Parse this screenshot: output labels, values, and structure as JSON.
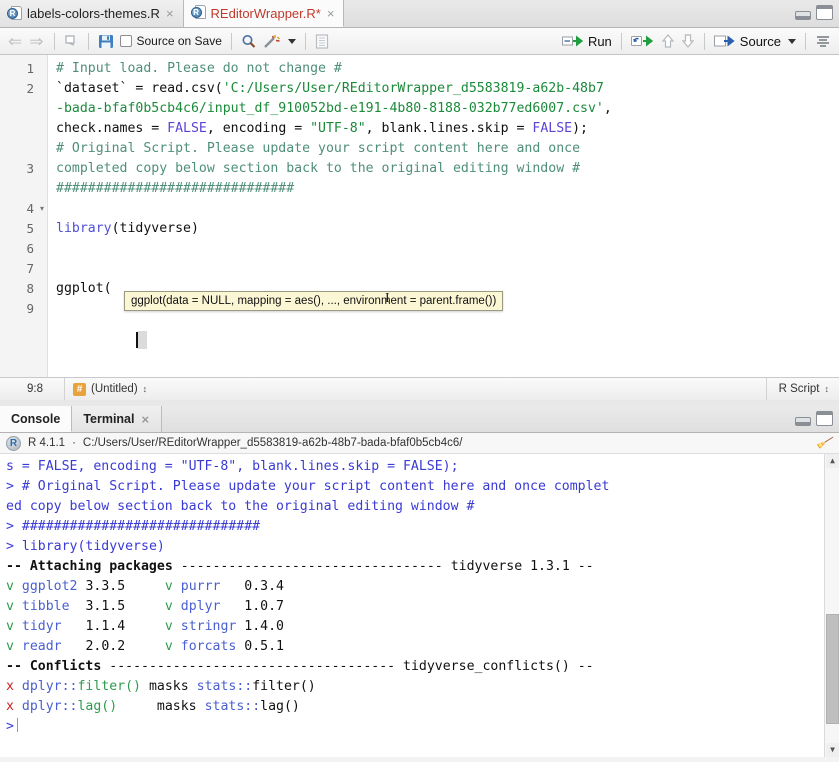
{
  "source_pane": {
    "tabs": [
      {
        "label": "labels-colors-themes.R",
        "modified": false,
        "active": false,
        "close": "×",
        "icon": "r-document-icon"
      },
      {
        "label": "REditorWrapper.R*",
        "modified": true,
        "active": true,
        "close": "×",
        "icon": "r-document-icon"
      }
    ],
    "window_controls": {
      "minimize": "minimize-icon",
      "maximize": "maximize-icon"
    },
    "toolbar": {
      "back": "⇐",
      "forward": "⇒",
      "show_document_outline_left": "popout-icon",
      "save_label": "save-icon",
      "source_on_save_label": "Source on Save",
      "find_label": "search-icon",
      "code_tools_label": "magic-wand-icon",
      "compile_report_label": "notebook-icon",
      "run_label": "Run",
      "rerun_label": "rerun-icon",
      "prev_chunk_label": "⇧",
      "next_chunk_label": "⇩",
      "source_label": "Source",
      "outline_label": "outline-icon"
    },
    "editor": {
      "lines": [
        {
          "num": "1",
          "fold": ""
        },
        {
          "num": "2",
          "fold": ""
        },
        {
          "num": "",
          "fold": ""
        },
        {
          "num": "",
          "fold": ""
        },
        {
          "num": "3",
          "fold": ""
        },
        {
          "num": "",
          "fold": ""
        },
        {
          "num": "4",
          "fold": "▾"
        },
        {
          "num": "5",
          "fold": ""
        },
        {
          "num": "6",
          "fold": ""
        },
        {
          "num": "7",
          "fold": ""
        },
        {
          "num": "8",
          "fold": ""
        },
        {
          "num": "9",
          "fold": ""
        }
      ],
      "code": {
        "l1_comment": "# Input load. Please do not change #",
        "l2_a": "`dataset` = read.csv(",
        "l2_str1": "'C:/Users/User/REditorWrapper_d5583819-a62b-48b7",
        "l2_str2": "-bada-bfaf0b5cb4c6/input_df_910052bd-e191-4b80-8188-032b77ed6007.csv'",
        "l2_b": ",",
        "l2_c": "check.names = ",
        "l2_false1": "FALSE",
        "l2_d": ", encoding = ",
        "l2_str3": "\"UTF-8\"",
        "l2_e": ", blank.lines.skip = ",
        "l2_false2": "FALSE",
        "l2_f": ");",
        "l3_comment_a": "# Original Script. Please update your script content here and once",
        "l3_comment_b": "completed copy below section back to the original editing window #",
        "l4_comment": "##############################",
        "l6_fn": "library",
        "l6_rest": "(tidyverse)",
        "l9_fn": "ggplot",
        "l9_rest": "("
      },
      "tooltip": "ggplot(data = NULL, mapping = aes(), ..., environment = parent.frame())",
      "cursor_glyph": "I"
    },
    "statusbar": {
      "position": "9:8",
      "scope_icon": "#",
      "scope": "(Untitled)",
      "scope_stepper": "↕",
      "doc_type": "R Script",
      "doc_type_stepper": "↕"
    }
  },
  "console_pane": {
    "tabs": [
      {
        "label": "Console",
        "active": true,
        "close": ""
      },
      {
        "label": "Terminal",
        "active": false,
        "close": "×"
      }
    ],
    "window_controls": {
      "minimize": "minimize-icon",
      "maximize": "maximize-icon"
    },
    "header": {
      "r_logo": "R",
      "version": "R 4.1.1",
      "separator": "·",
      "working_dir": "C:/Users/User/REditorWrapper_d5583819-a62b-48b7-bada-bfaf0b5cb4c6/",
      "clear_icon": "broom-icon"
    },
    "output": {
      "line1": "s = FALSE, encoding = \"UTF-8\", blank.lines.skip = FALSE);",
      "prompt": ">",
      "line2a": "# Original Script. Please update your script content here and once complet",
      "line2b": "ed copy below section back to the original editing window #",
      "line3": "##############################",
      "line4": "library(tidyverse)",
      "attach_dashes_left": "--",
      "attach_title": "Attaching packages",
      "attach_dashes_mid": "---------------------------------",
      "attach_right": "tidyverse 1.3.1 --",
      "packages": [
        {
          "check": "v",
          "name": "ggplot2",
          "version": "3.3.5",
          "check2": "v",
          "name2": "purrr",
          "version2": "0.3.4"
        },
        {
          "check": "v",
          "name": "tibble",
          "version": "3.1.5",
          "check2": "v",
          "name2": "dplyr",
          "version2": "1.0.7"
        },
        {
          "check": "v",
          "name": "tidyr",
          "version": "1.1.4",
          "check2": "v",
          "name2": "stringr",
          "version2": "1.4.0"
        },
        {
          "check": "v",
          "name": "readr",
          "version": "2.0.2",
          "check2": "v",
          "name2": "forcats",
          "version2": "0.5.1"
        }
      ],
      "conflicts_dashes_left": "--",
      "conflicts_title": "Conflicts",
      "conflicts_dashes_mid": "------------------------------------",
      "conflicts_right": "tidyverse_conflicts() --",
      "conflicts": [
        {
          "mark": "x",
          "pkg": "dplyr::",
          "fn": "filter()",
          "masks": "masks",
          "masked_pkg": "stats::",
          "masked_fn": "filter()",
          "pad": " "
        },
        {
          "mark": "x",
          "pkg": "dplyr::",
          "fn": "lag()",
          "masks": "masks",
          "masked_pkg": "stats::",
          "masked_fn": "lag()",
          "pad": "    "
        }
      ],
      "final_prompt": ">"
    },
    "scrollbar": {
      "up": "▲",
      "down": "▼"
    }
  },
  "colors": {
    "comment": "#4f8f78",
    "string": "#1b8a3a",
    "keyword": "#5c43d6",
    "console_blue": "#3a3ad4",
    "check_green": "#2e9b4e",
    "conflict_red": "#cc2121",
    "tab_modified": "#c0392b"
  }
}
